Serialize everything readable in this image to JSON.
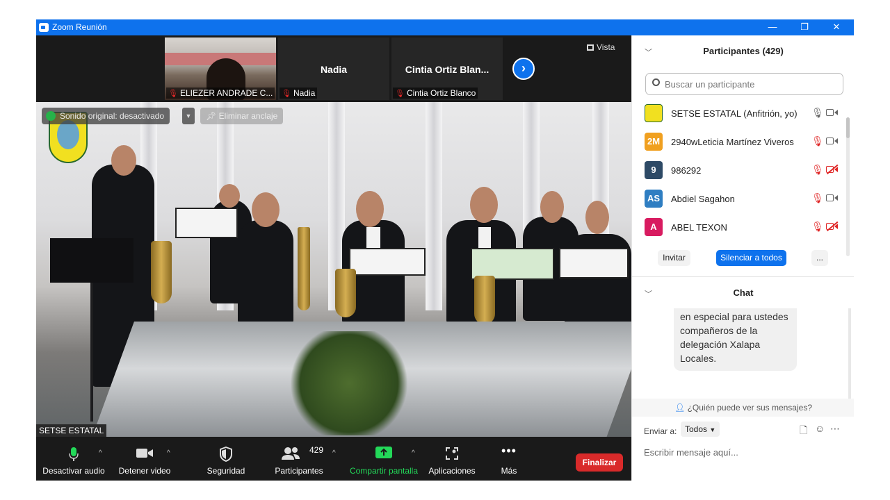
{
  "window": {
    "title": "Zoom Reunión",
    "controls": {
      "minimize": "—",
      "restore": "❐",
      "close": "✕"
    }
  },
  "filmstrip": {
    "tiles": [
      {
        "label": "ELIEZER ANDRADE C..."
      },
      {
        "name": "Nadia",
        "label": "Nadia"
      },
      {
        "name": "Cintia  Ortiz  Blan...",
        "label": "Cintia Ortiz Blanco"
      }
    ],
    "next_arrow": "›",
    "view_button": "Vista"
  },
  "main_video": {
    "audio_status": "Sonido original: desactivado",
    "unpin": "Eliminar anclaje",
    "name_tag": "SETSE ESTATAL"
  },
  "toolbar": {
    "mute": "Desactivar audio",
    "stop_video": "Detener video",
    "security": "Seguridad",
    "participants": "Participantes",
    "participants_count": "429",
    "share": "Compartir pantalla",
    "apps": "Aplicaciones",
    "more": "Más",
    "end": "Finalizar"
  },
  "participants_panel": {
    "title": "Participantes (429)",
    "search_placeholder": "Buscar un participante",
    "participants": [
      {
        "initials": "",
        "name": "SETSE ESTATAL (Anfitrión, yo)",
        "color": "#f1e020",
        "mic": "on",
        "cam": "on"
      },
      {
        "initials": "2M",
        "name": "2940wLeticia Martínez Viveros",
        "color": "#f0a020",
        "mic": "off",
        "cam": "on"
      },
      {
        "initials": "9",
        "name": "986292",
        "color": "#2e4a66",
        "mic": "off",
        "cam": "off"
      },
      {
        "initials": "AS",
        "name": "Abdiel Sagahon",
        "color": "#2f7ec2",
        "mic": "off",
        "cam": "on"
      },
      {
        "initials": "A",
        "name": "ABEL TEXON",
        "color": "#d81b60",
        "mic": "off",
        "cam": "off"
      }
    ],
    "invite": "Invitar",
    "mute_all": "Silenciar a todos",
    "more": "..."
  },
  "chat": {
    "title": "Chat",
    "message": "en especial para ustedes compañeros de la delegación Xalapa Locales.",
    "who_can_see": "¿Quién puede ver sus mensajes?",
    "send_to_label": "Enviar a:",
    "send_to_value": "Todos",
    "input_placeholder": "Escribir mensaje aquí..."
  }
}
